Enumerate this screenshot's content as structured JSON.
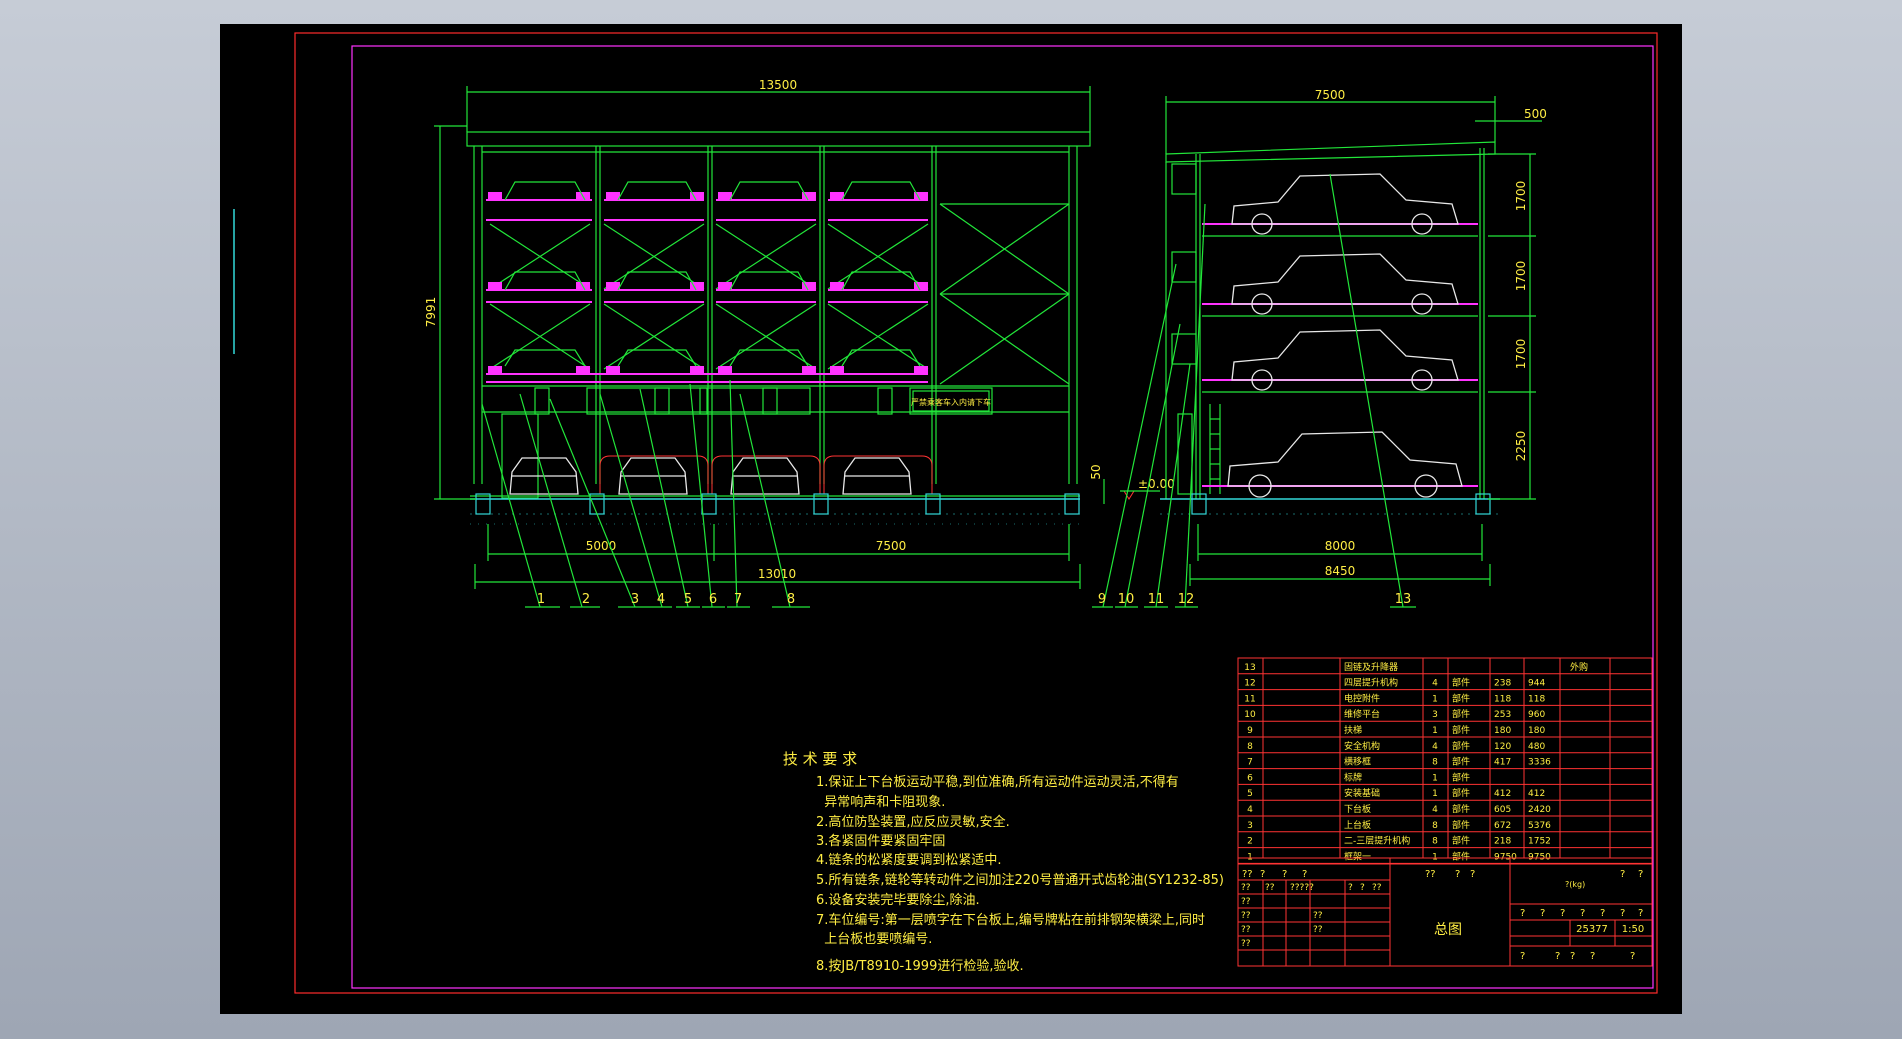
{
  "dimensions": {
    "front_width": "13500",
    "front_height": "7991",
    "front_left_span": "5000",
    "front_right_span": "7500",
    "front_total": "13010",
    "pit_depth": "50",
    "ground_level": "±0.00",
    "side_width": "7500",
    "side_overhang": "500",
    "side_span": "8000",
    "side_total": "8450",
    "level_heights": [
      "1700",
      "1700",
      "1700",
      "2250"
    ]
  },
  "balloons": [
    "1",
    "2",
    "3",
    "4",
    "5",
    "6",
    "7",
    "8",
    "9",
    "10",
    "11",
    "12",
    "13"
  ],
  "notice_sign": "严禁乘客车入内请下车",
  "tech_requirements": {
    "title": "技 术 要 求",
    "items": [
      "1.保证上下台板运动平稳,到位准确,所有运动件运动灵活,不得有",
      "  异常响声和卡阻现象.",
      "2.高位防坠装置,应反应灵敏,安全.",
      "3.各紧固件要紧固牢固",
      "4.链条的松紧度要调到松紧适中.",
      "5.所有链条,链轮等转动件之间加注220号普通开式齿轮油(SY1232-85)",
      "6.设备安装完毕要除尘,除油.",
      "7.车位编号:第一层喷字在下台板上,编号牌粘在前排钢架横梁上,同时",
      "  上台板也要喷编号.",
      "8.按JB/T8910-1999进行检验,验收."
    ]
  },
  "bom": {
    "rows": [
      {
        "no": "13",
        "name": "固链及升降器",
        "qty": "",
        "type": "",
        "w1": "",
        "w2": "",
        "note": "外购"
      },
      {
        "no": "12",
        "name": "四层提升机构",
        "qty": "4",
        "type": "部件",
        "w1": "238",
        "w2": "944",
        "note": ""
      },
      {
        "no": "11",
        "name": "电控附件",
        "qty": "1",
        "type": "部件",
        "w1": "118",
        "w2": "118",
        "note": ""
      },
      {
        "no": "10",
        "name": "维修平台",
        "qty": "3",
        "type": "部件",
        "w1": "253",
        "w2": "960",
        "note": ""
      },
      {
        "no": "9",
        "name": "扶梯",
        "qty": "1",
        "type": "部件",
        "w1": "180",
        "w2": "180",
        "note": ""
      },
      {
        "no": "8",
        "name": "安全机构",
        "qty": "4",
        "type": "部件",
        "w1": "120",
        "w2": "480",
        "note": ""
      },
      {
        "no": "7",
        "name": "横移框",
        "qty": "8",
        "type": "部件",
        "w1": "417",
        "w2": "3336",
        "note": ""
      },
      {
        "no": "6",
        "name": "标牌",
        "qty": "1",
        "type": "部件",
        "w1": "",
        "w2": "",
        "note": ""
      },
      {
        "no": "5",
        "name": "安装基础",
        "qty": "1",
        "type": "部件",
        "w1": "412",
        "w2": "412",
        "note": ""
      },
      {
        "no": "4",
        "name": "下台板",
        "qty": "4",
        "type": "部件",
        "w1": "605",
        "w2": "2420",
        "note": ""
      },
      {
        "no": "3",
        "name": "上台板",
        "qty": "8",
        "type": "部件",
        "w1": "672",
        "w2": "5376",
        "note": ""
      },
      {
        "no": "2",
        "name": "二-三层提升机构",
        "qty": "8",
        "type": "部件",
        "w1": "218",
        "w2": "1752",
        "note": ""
      },
      {
        "no": "1",
        "name": "框架一",
        "qty": "1",
        "type": "部件",
        "w1": "9750",
        "w2": "9750",
        "note": ""
      }
    ],
    "header_placeholders": [
      "??",
      "?",
      "?",
      "?",
      "??",
      "?",
      "?",
      "?",
      "?"
    ],
    "weight_label": "?(kg)"
  },
  "title_block": {
    "drawing_title": "总图",
    "weight": "25377",
    "scale": "1:50",
    "placeholders_top": [
      "?",
      "?",
      "?",
      "?",
      "?",
      "?",
      "?"
    ],
    "placeholders_bottom": [
      "?",
      "?",
      "?",
      "?",
      "?"
    ],
    "rev_marks": [
      "??",
      "??",
      "?????",
      "?",
      "?",
      "??"
    ],
    "sign_marks": [
      "??",
      "??",
      "??",
      "??",
      "??",
      "??"
    ]
  },
  "colors": {
    "background": "#000000",
    "frame": "#ff2b2b",
    "border": "#ff33ff",
    "geometry": "#22e63a",
    "accent": "#ff33ff",
    "cars": "#e8e8e8",
    "ground": "#33d9d9",
    "text": "#ffee44"
  }
}
